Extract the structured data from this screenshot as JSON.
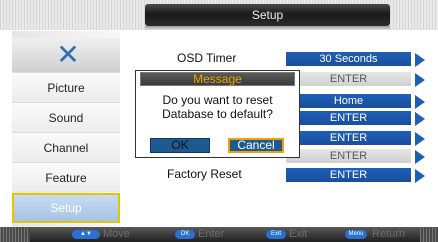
{
  "title": "Setup",
  "sidebar": {
    "items": [
      {
        "label": "Picture"
      },
      {
        "label": "Sound"
      },
      {
        "label": "Channel"
      },
      {
        "label": "Feature"
      },
      {
        "label": "Setup"
      }
    ],
    "tools_icon": "tools-icon"
  },
  "rows": [
    {
      "label": "OSD Timer",
      "value": "30 Seconds"
    },
    {
      "label": "",
      "value": "ENTER"
    },
    {
      "label": "",
      "value": "Home"
    },
    {
      "label": "",
      "value": "ENTER"
    },
    {
      "label": "",
      "value": "ENTER"
    },
    {
      "label": "",
      "value": "ENTER"
    },
    {
      "label": "Factory Reset",
      "value": "ENTER"
    }
  ],
  "dialog": {
    "title": "Message",
    "message_line1": "Do you want to reset",
    "message_line2": "Database to  default?",
    "ok": "OK",
    "cancel": "Cancel"
  },
  "footer": {
    "move_key": "▲▼",
    "move": "Move",
    "enter_key": "OK",
    "enter": "Enter",
    "exit_key": "Exit",
    "exit": "Exit",
    "return_key": "Menu",
    "return": "Return"
  },
  "colors": {
    "accent_blue": "#1f5fb7",
    "highlight_yellow": "#e5c400",
    "dialog_title_text": "#e8a800"
  }
}
